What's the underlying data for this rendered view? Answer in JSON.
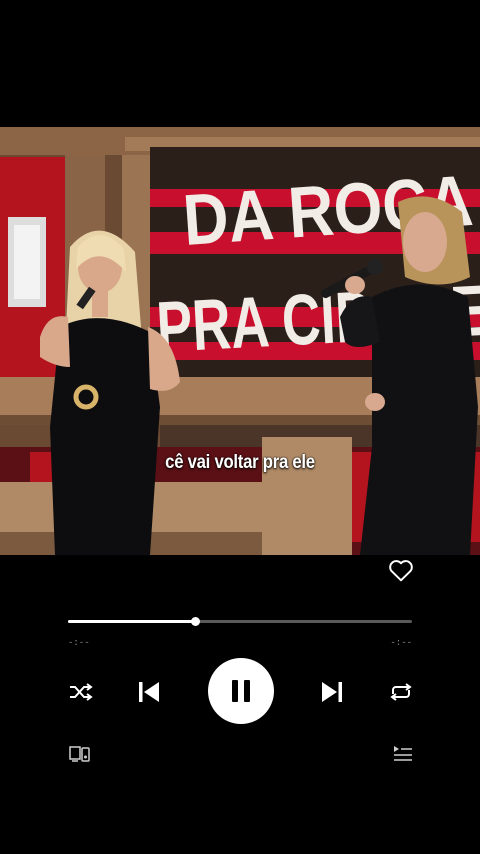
{
  "video": {
    "sign_line1": "DA ROÇA",
    "sign_line2": "PRA CIDADE",
    "subtitle": "cê vai voltar pra ele"
  },
  "player": {
    "progress": 0.37,
    "time_elapsed": "-:--",
    "time_remaining": "-:--",
    "playing": true
  },
  "icons": {
    "like": "heart-icon",
    "shuffle": "shuffle-icon",
    "previous": "skip-previous-icon",
    "pause": "pause-icon",
    "next": "skip-next-icon",
    "repeat": "repeat-icon",
    "devices": "devices-icon",
    "queue": "queue-icon"
  },
  "colors": {
    "background": "#000000",
    "track": "#5a5a5a",
    "accent": "#ffffff",
    "sign_red": "#c8102e"
  }
}
